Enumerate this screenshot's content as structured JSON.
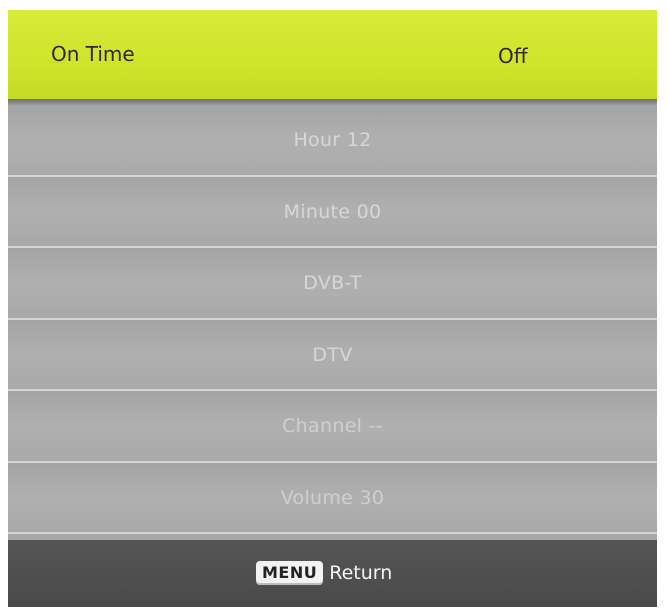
{
  "header": {
    "label": "On Time",
    "value": "Off"
  },
  "items": [
    {
      "text": "Hour 12"
    },
    {
      "text": "Minute 00"
    },
    {
      "text": "DVB-T"
    },
    {
      "text": "DTV"
    },
    {
      "text": "Channel --"
    },
    {
      "text": "Volume 30"
    }
  ],
  "footer": {
    "key_label": "MENU",
    "action_label": "Return"
  },
  "colors": {
    "highlight": "#cfe52c",
    "menu_bg": "#a8a8a8",
    "footer_bg": "#4e4e4e"
  }
}
